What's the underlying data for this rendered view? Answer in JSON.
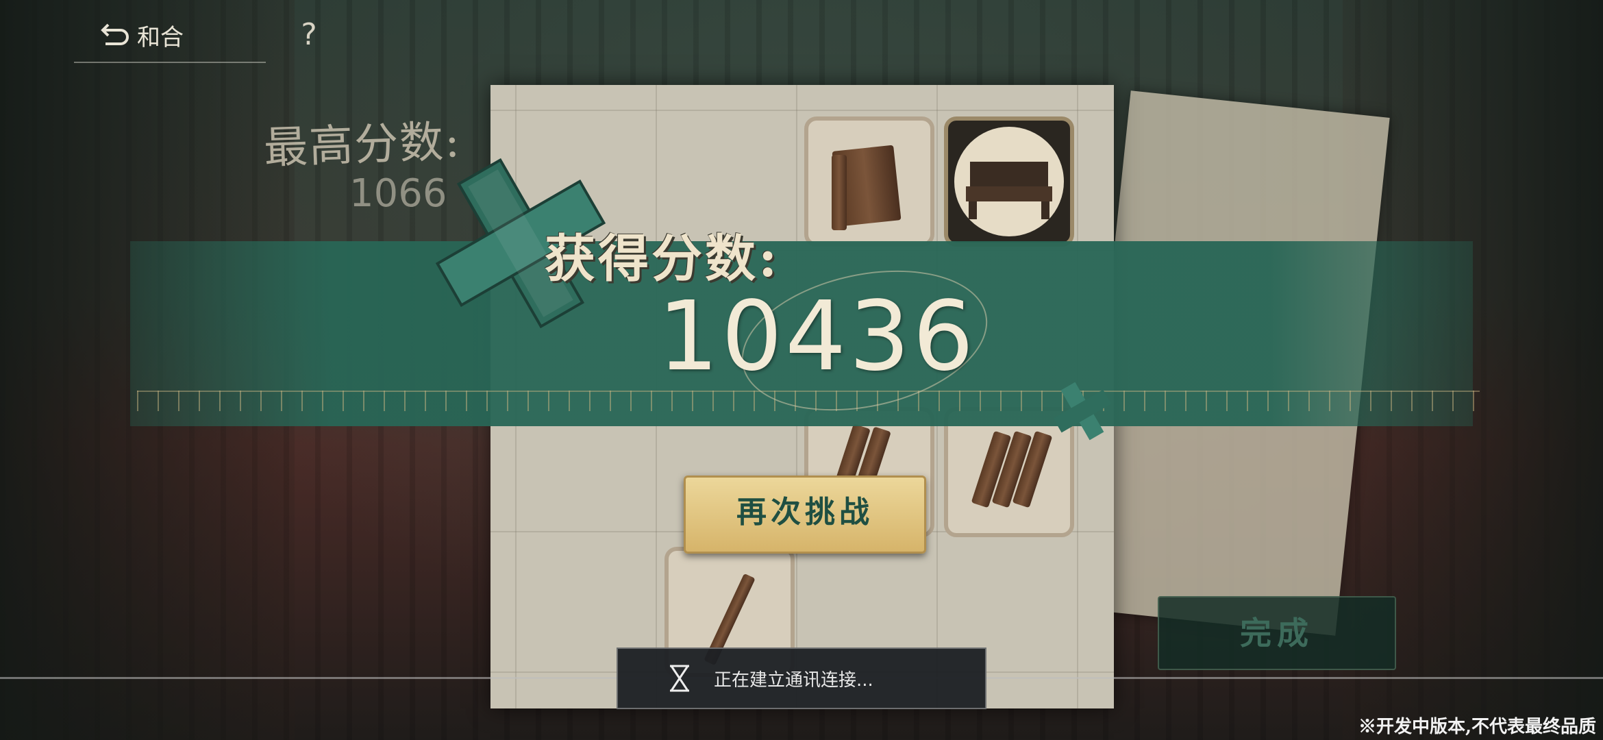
{
  "nav": {
    "back_label": "和合",
    "help_label": "?"
  },
  "best": {
    "label": "最高分数:",
    "value": "1066"
  },
  "result": {
    "label": "获得分数:",
    "score": "10436"
  },
  "buttons": {
    "retry": "再次挑战",
    "done": "完成"
  },
  "status": {
    "connecting": "正在建立通讯连接..."
  },
  "footer": {
    "notice": "※开发中版本,不代表最终品质"
  },
  "colors": {
    "band_green": "#28665a",
    "button_gold": "#e3c583",
    "text_cream": "#f2ead6"
  }
}
